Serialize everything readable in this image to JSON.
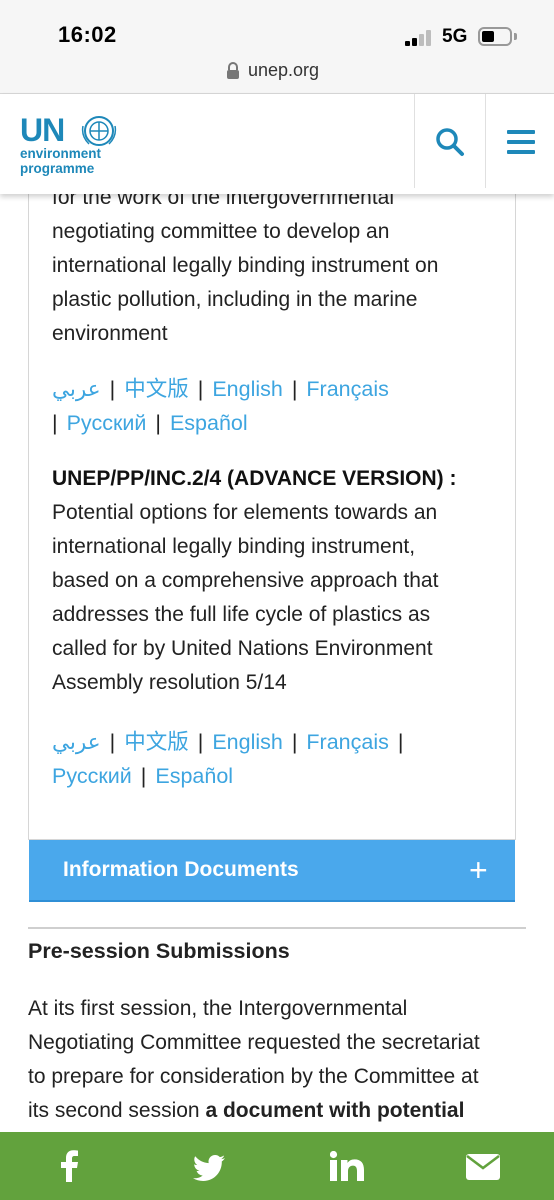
{
  "status_bar": {
    "time": "16:02",
    "network": "5G"
  },
  "browser": {
    "url": "unep.org"
  },
  "header": {
    "logo_un": "UN",
    "logo_line1": "environment",
    "logo_line2": "programme",
    "search_icon": "search-icon",
    "menu_icon": "menu-icon"
  },
  "panel": {
    "intro_lines": [
      "for the work of the intergovernmental",
      "negotiating committee to develop an",
      "international legally binding instrument on",
      "plastic pollution, including in the marine",
      "environment"
    ],
    "languages_1": {
      "arabic": "عربي",
      "chinese": "中文版",
      "english": "English",
      "french": "Français",
      "russian": "Русский",
      "spanish": "Español"
    },
    "doc2_code": "UNEP/PP/INC.2/4 (ADVANCE VERSION) :",
    "doc2_lines": [
      "Potential options for elements towards an",
      "international legally binding instrument,",
      "based on a comprehensive approach that",
      "addresses the full life cycle of plastics as",
      "called for by United Nations Environment",
      "Assembly resolution 5/14"
    ],
    "languages_2": {
      "arabic": "عربي",
      "chinese": "中文版",
      "english": "English",
      "french": "Français",
      "russian": "Русский",
      "spanish": "Español"
    },
    "separator": "|"
  },
  "accordion": {
    "title": "Information Documents",
    "toggle": "+"
  },
  "section": {
    "title": "Pre-session Submissions",
    "lines": [
      "At its first session, the Intergovernmental",
      "Negotiating Committee requested the secretariat",
      "to prepare for consideration by the Committee at"
    ],
    "last_line_plain": "its second session ",
    "last_line_bold": "a document with potential"
  },
  "share_bar": {
    "icons": [
      "facebook-icon",
      "twitter-icon",
      "linkedin-icon",
      "email-icon"
    ],
    "background": "#62a23d"
  },
  "colors": {
    "brand_blue": "#1e88b9",
    "link": "#3da5e0",
    "accordion": "#4aa8ec"
  }
}
